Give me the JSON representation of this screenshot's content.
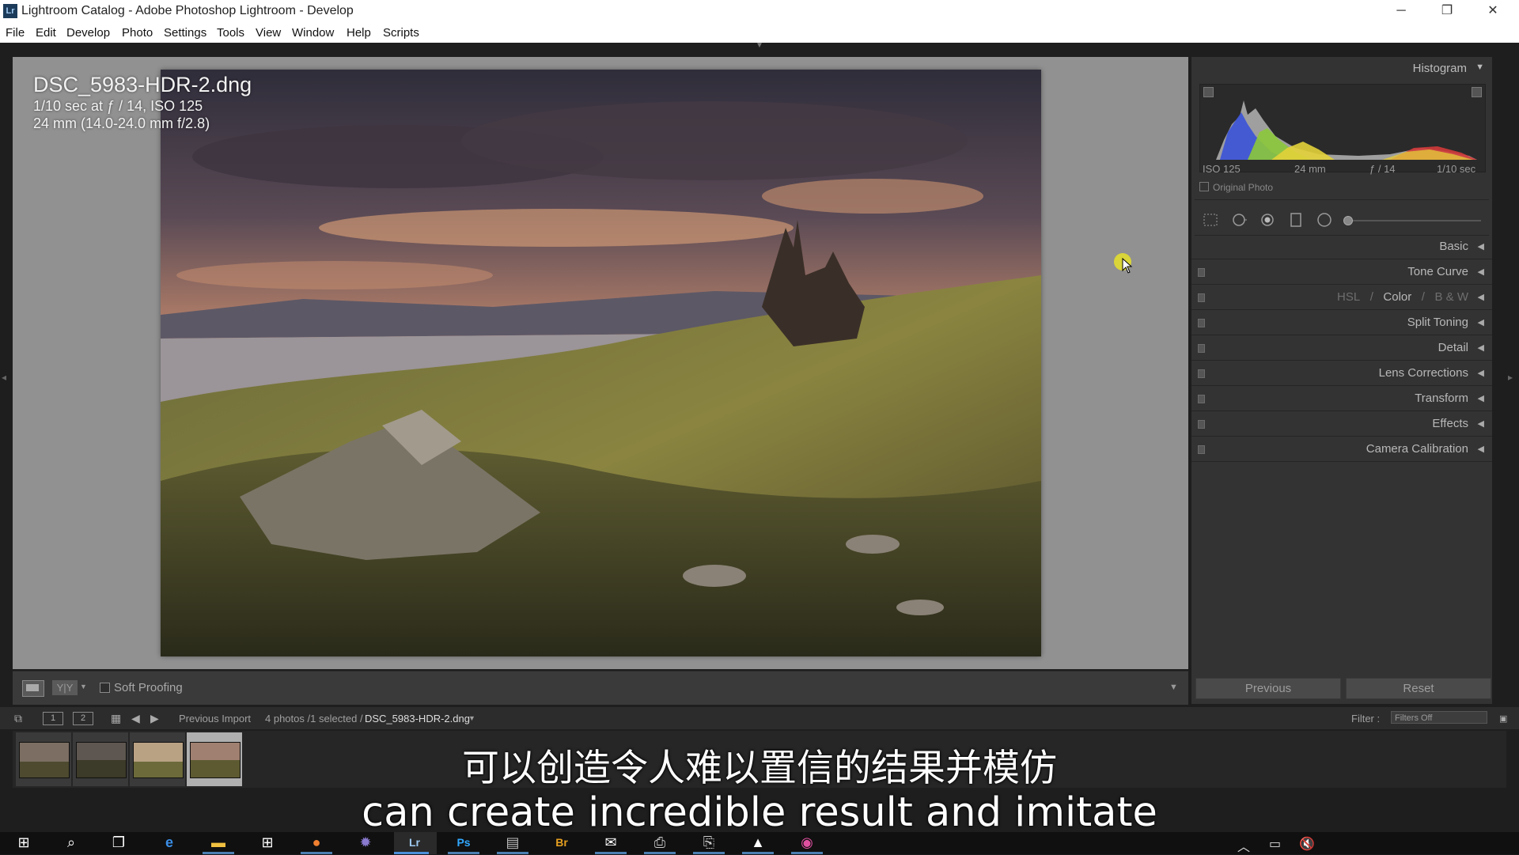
{
  "window": {
    "app_icon": "Lr",
    "title": "Lightroom Catalog - Adobe Photoshop Lightroom - Develop",
    "minimize": "─",
    "maximize": "❐",
    "close": "✕"
  },
  "menu": [
    "File",
    "Edit",
    "Develop",
    "Photo",
    "Settings",
    "Tools",
    "View",
    "Window",
    "Help",
    "Scripts"
  ],
  "photo_info": {
    "filename": "DSC_5983-HDR-2.dng",
    "exposure": "1/10 sec at ƒ / 14, ISO 125",
    "lens": "24 mm (14.0-24.0 mm f/2.8)"
  },
  "toolbar": {
    "view_yy": "Y|Y",
    "soft_proofing": "Soft Proofing"
  },
  "right_panel": {
    "histogram_label": "Histogram",
    "histogram_meta": {
      "iso": "ISO 125",
      "focal": "24 mm",
      "aperture": "ƒ / 14",
      "shutter": "1/10 sec"
    },
    "original_photo": "Original Photo",
    "sections": [
      {
        "label": "Basic"
      },
      {
        "label": "Tone Curve"
      },
      {
        "label": "HSL / Color / B & W"
      },
      {
        "label": "Split Toning"
      },
      {
        "label": "Detail"
      },
      {
        "label": "Lens Corrections"
      },
      {
        "label": "Transform"
      },
      {
        "label": "Effects"
      },
      {
        "label": "Camera Calibration"
      }
    ],
    "hsl_parts": {
      "hsl": "HSL",
      "sep1": "/",
      "color": "Color",
      "sep2": "/",
      "bw": "B & W"
    },
    "previous_button": "Previous",
    "reset_button": "Reset"
  },
  "filmstrip_bar": {
    "page1": "1",
    "page2": "2",
    "source": "Previous Import",
    "count": "4 photos /1 selected /",
    "selected_file": "DSC_5983-HDR-2.dng",
    "filter_label": "Filter :",
    "filter_value": "Filters Off"
  },
  "subtitles": {
    "chinese": "可以创造令人难以置信的结果并模仿",
    "english": "can create incredible result and imitate"
  },
  "taskbar": {
    "apps": [
      "windows-start",
      "search",
      "task-view",
      "edge",
      "file-explorer",
      "store",
      "firefox",
      "settings-gear",
      "lightroom",
      "photoshop",
      "folder-app",
      "bridge",
      "mail",
      "printer-app",
      "scanner-app",
      "photos",
      "color-app"
    ]
  }
}
